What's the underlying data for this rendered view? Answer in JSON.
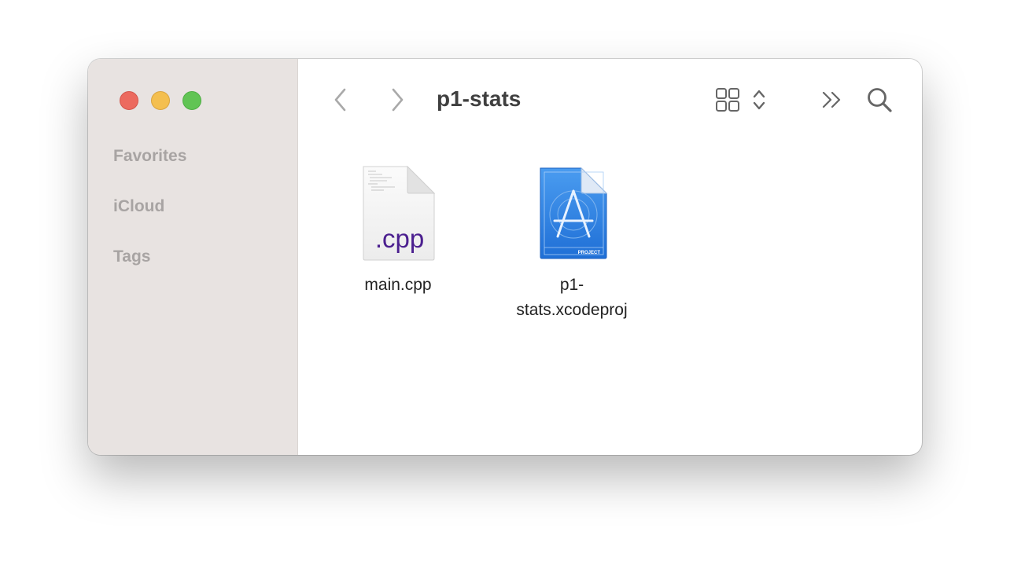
{
  "window": {
    "title": "p1-stats"
  },
  "sidebar": {
    "sections": [
      {
        "label": "Favorites"
      },
      {
        "label": "iCloud"
      },
      {
        "label": "Tags"
      }
    ]
  },
  "toolbar": {
    "back_icon": "chevron-left-icon",
    "forward_icon": "chevron-right-icon",
    "view_icon": "icon-grid-view-icon",
    "view_switch_icon": "up-down-chevron-icon",
    "more_icon": "double-chevron-right-icon",
    "search_icon": "magnifying-glass-icon"
  },
  "files": [
    {
      "name": "main.cpp",
      "icon_text": ".cpp",
      "icon": "cpp-document-icon"
    },
    {
      "name_line1": "p1-",
      "name_line2": "stats.xcodeproj",
      "icon_text": "PROJECT",
      "icon": "xcode-project-icon"
    }
  ],
  "colors": {
    "sidebar_bg": "#e8e3e1",
    "close": "#ec6a5f",
    "minimize": "#f4bf4f",
    "zoom": "#61c454",
    "cpp_text": "#4b1f8f",
    "xcode_blue": "#2f7fe0"
  }
}
